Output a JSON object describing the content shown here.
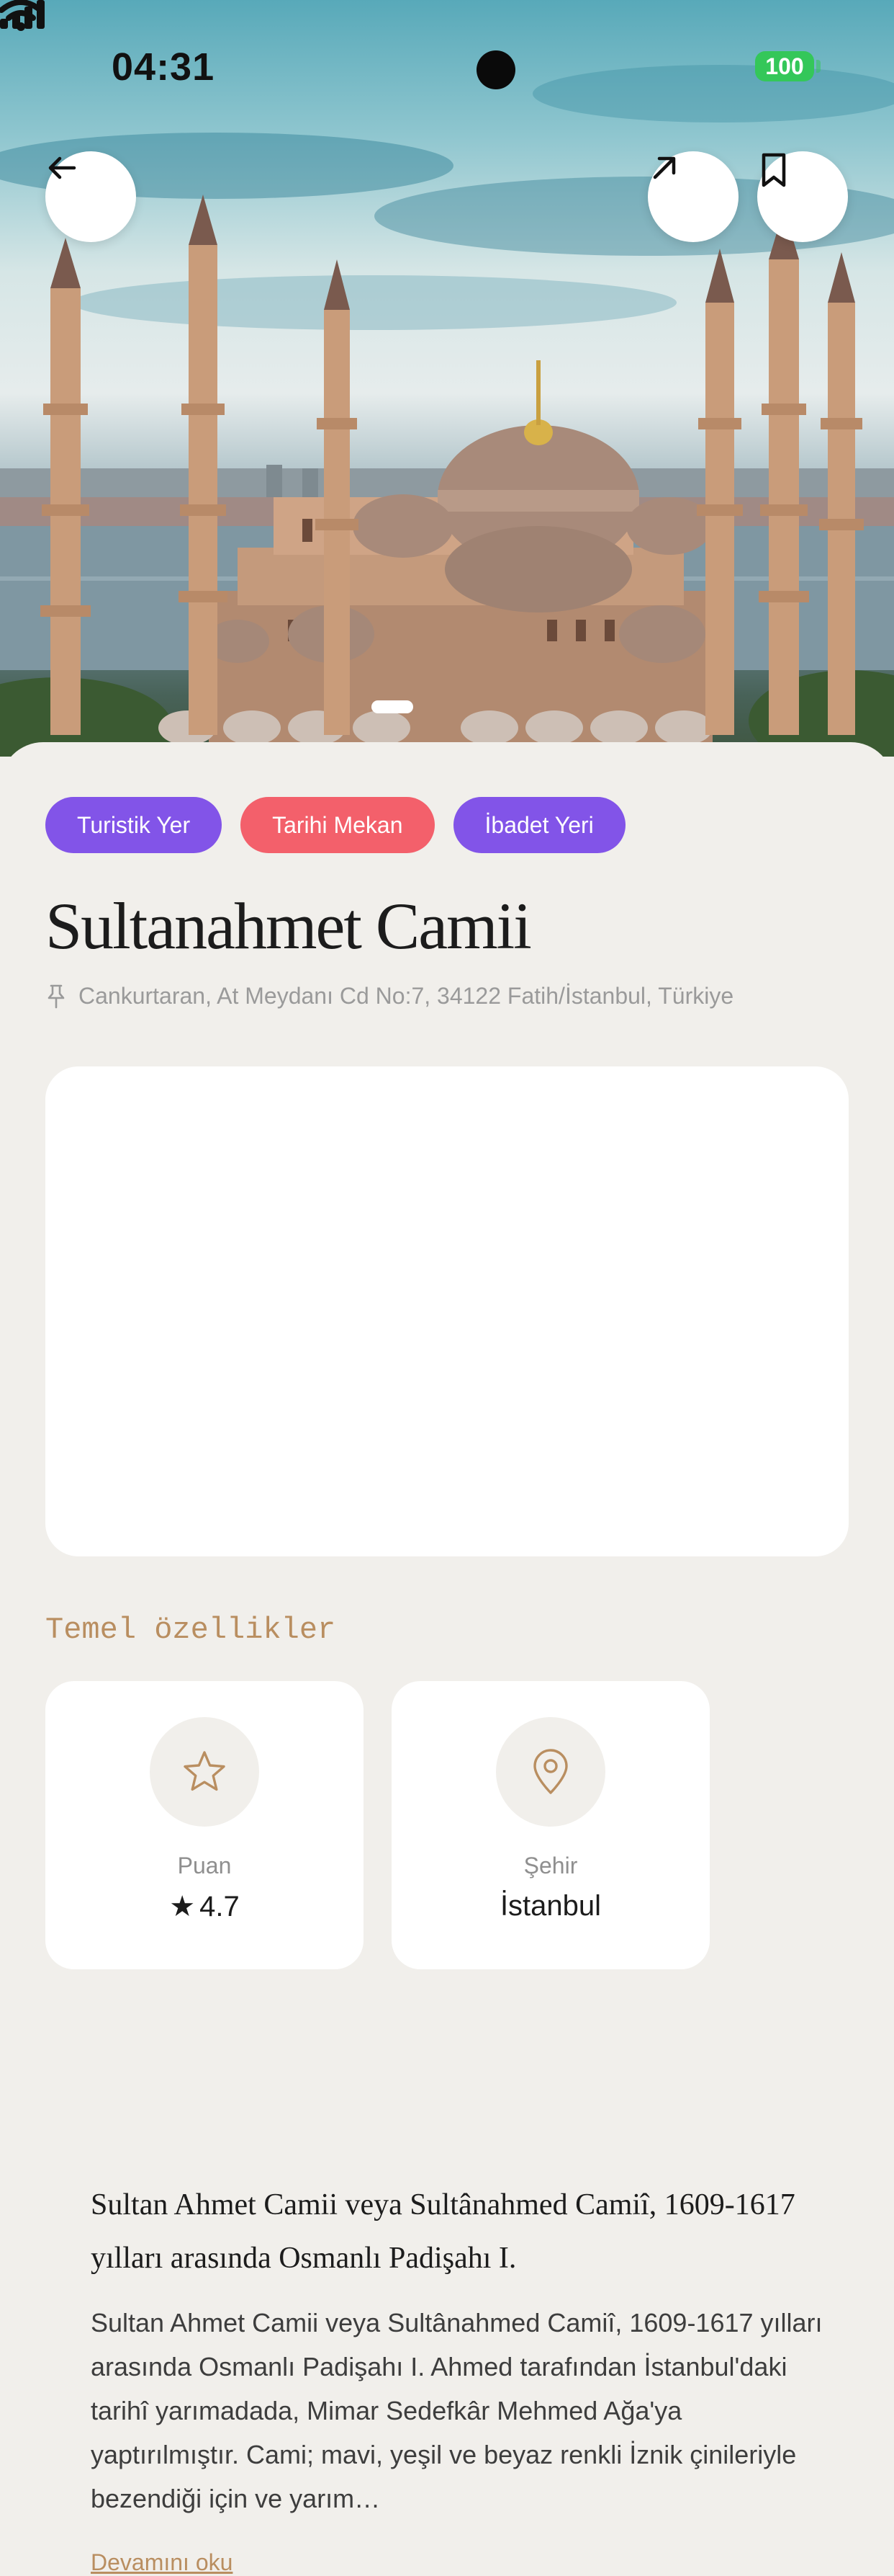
{
  "status_bar": {
    "time": "04:31",
    "battery": "100"
  },
  "colors": {
    "accent_purple": "#8254e8",
    "accent_red": "#f3606b",
    "brown": "#b98e60",
    "sheet": "#f1efeb"
  },
  "hero": {
    "back_icon": "arrow-left-icon",
    "share_icon": "arrow-up-right-icon",
    "save_icon": "bookmark-icon"
  },
  "tags": [
    {
      "label": "Turistik Yer",
      "color": "purple"
    },
    {
      "label": "Tarihi Mekan",
      "color": "red"
    },
    {
      "label": "İbadet Yeri",
      "color": "purple"
    }
  ],
  "place": {
    "title": "Sultanahmet Camii",
    "address": "Cankurtaran, At Meydanı Cd No:7, 34122 Fatih/İstanbul, Türkiye"
  },
  "description": {
    "lead": "Sultan Ahmet Camii veya Sultânahmed Camiî, 1609-1617 yılları arasında Osmanlı Padişahı I.",
    "body": "Sultan Ahmet Camii veya Sultânahmed Camiî, 1609-1617 yılları arasında Osmanlı Padişahı I. Ahmed tarafından İstanbul'daki tarihî yarımadada, Mimar Sedefkâr Mehmed Ağa'ya yaptırılmıştır. Cami; mavi, yeşil ve beyaz renkli İznik çinileriyle bezendiği için ve yarım…",
    "read_more": "Devamını oku"
  },
  "features": {
    "section_title": "Temel özellikler",
    "items": [
      {
        "icon": "star-icon",
        "label": "Puan",
        "star": "★",
        "value": "4.7"
      },
      {
        "icon": "location-pin-icon",
        "label": "Şehir",
        "value": "İstanbul"
      }
    ]
  }
}
